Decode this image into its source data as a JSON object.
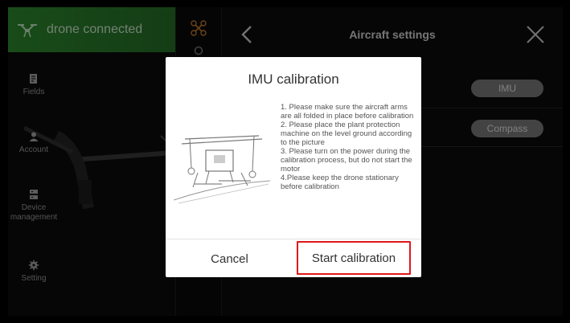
{
  "connection": {
    "status_text": "drone connected",
    "icon": "drone-icon",
    "banner_color": "#2e8a2e"
  },
  "sidebar": {
    "items": [
      {
        "label": "Fields",
        "icon": "fields-icon"
      },
      {
        "label": "Account",
        "icon": "account-icon"
      },
      {
        "label": "Device management",
        "icon": "device-icon"
      },
      {
        "label": "Setting",
        "icon": "gear-icon"
      }
    ]
  },
  "header": {
    "title": "Aircraft settings",
    "back_icon": "chevron-left-icon",
    "close_icon": "close-icon"
  },
  "settings": {
    "rows": [
      {
        "button_label": "IMU"
      },
      {
        "button_label": "Compass"
      }
    ]
  },
  "dialog": {
    "title": "IMU calibration",
    "instructions": [
      "1. Please make sure the aircraft arms are all folded in place before calibration",
      "2. Please place the plant protection machine on the level ground according to the picture",
      "3. Please turn on the power during the calibration process, but do not start the motor",
      "4.Please keep the drone stationary before calibration"
    ],
    "cancel_label": "Cancel",
    "start_label": "Start calibration",
    "highlight_color": "#e0161b"
  }
}
